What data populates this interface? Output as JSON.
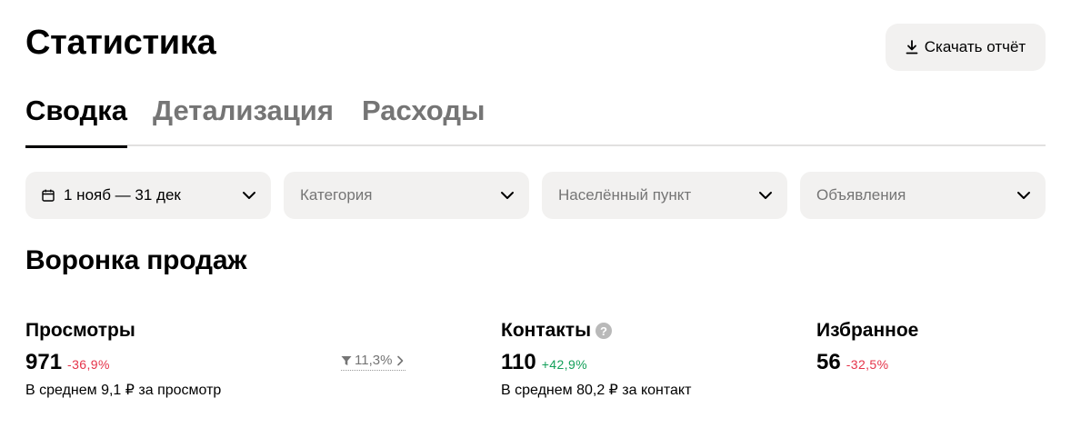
{
  "header": {
    "title": "Статистика",
    "download_label": "Скачать отчёт"
  },
  "tabs": [
    {
      "label": "Сводка",
      "active": true
    },
    {
      "label": "Детализация",
      "active": false
    },
    {
      "label": "Расходы",
      "active": false
    }
  ],
  "filters": {
    "period": {
      "value": "1 нояб — 31 дек"
    },
    "category": {
      "placeholder": "Категория"
    },
    "location": {
      "placeholder": "Населённый пункт"
    },
    "listings": {
      "placeholder": "Объявления"
    }
  },
  "funnel": {
    "title": "Воронка продаж",
    "views": {
      "label": "Просмотры",
      "value": "971",
      "delta": "-36,9%",
      "average": "В среднем 9,1 ₽ за просмотр"
    },
    "conversion": {
      "value": "11,3%"
    },
    "contacts": {
      "label": "Контакты",
      "help": "?",
      "value": "110",
      "delta": "+42,9%",
      "average": "В среднем 80,2 ₽ за контакт"
    },
    "favorites": {
      "label": "Избранное",
      "value": "56",
      "delta": "-32,5%"
    }
  },
  "colors": {
    "negative": "#e5344a",
    "positive": "#14a05a",
    "control_bg": "#f2f1f0",
    "muted_text": "#757575"
  },
  "icons": {
    "download": "download-icon",
    "calendar": "calendar-icon",
    "chevron": "chevron-down-icon",
    "filter": "funnel-icon",
    "help": "question-icon"
  }
}
